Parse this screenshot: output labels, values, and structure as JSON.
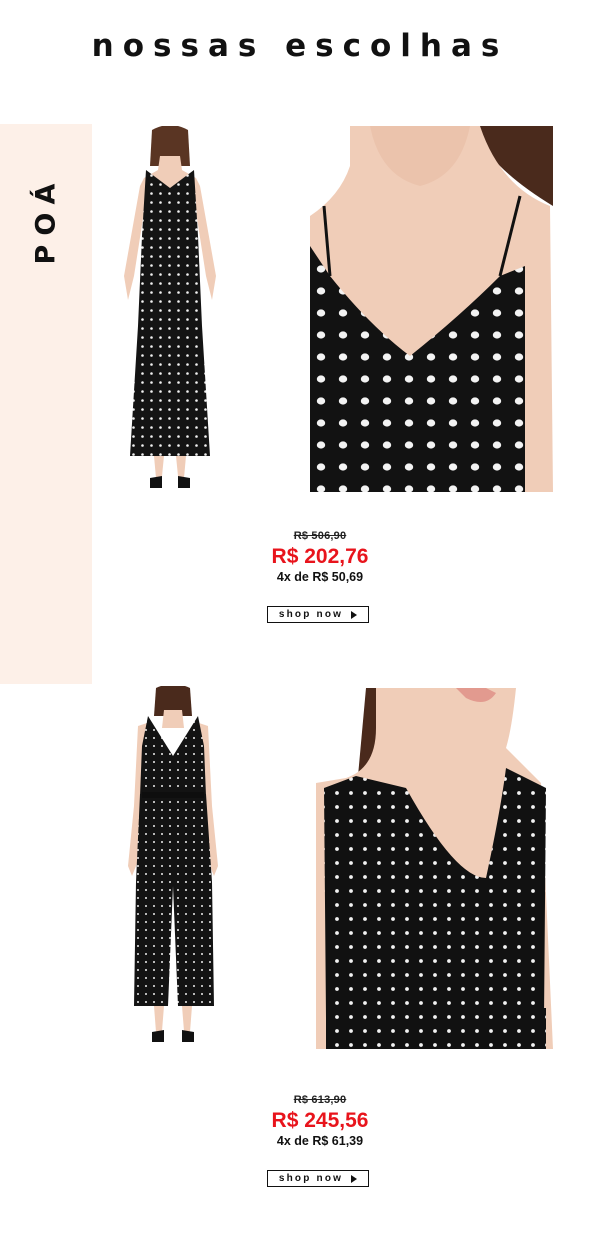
{
  "header": {
    "title": "nossas escolhas"
  },
  "section": {
    "label": "POÁ"
  },
  "products": [
    {
      "name": "dress-polka",
      "old_price": "R$ 506,90",
      "price": "R$ 202,76",
      "installments": "4x de R$ 50,69",
      "cta": "shop now"
    },
    {
      "name": "jumpsuit-polka",
      "old_price": "R$ 613,90",
      "price": "R$ 245,56",
      "installments": "4x de R$ 61,39",
      "cta": "shop now"
    }
  ],
  "colors": {
    "accent_price": "#e8141c",
    "side_band": "#fdf0e8",
    "garment": "#111111",
    "skin": "#f0cdb8"
  }
}
